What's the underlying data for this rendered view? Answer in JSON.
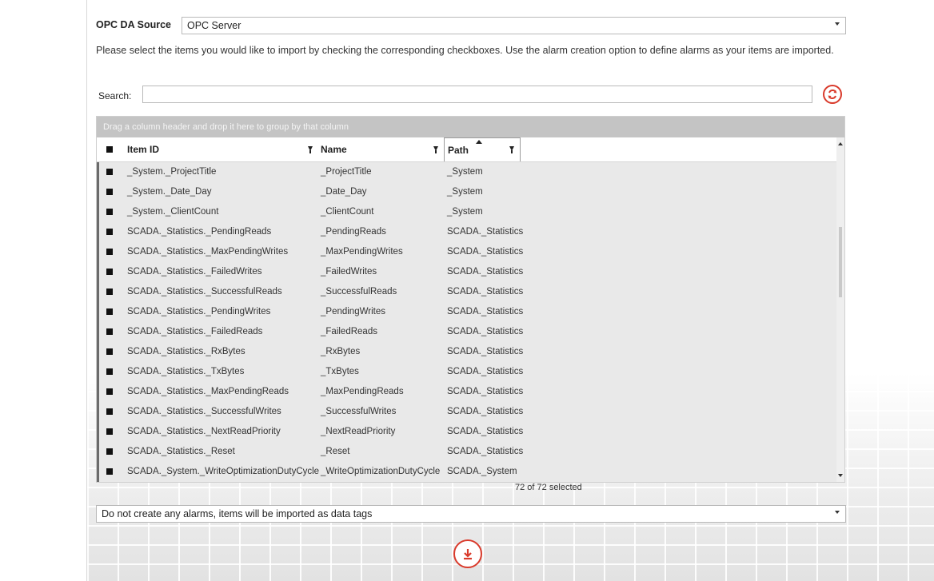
{
  "source": {
    "label": "OPC DA Source",
    "value": "OPC Server"
  },
  "instructions": "Please select the items you would like to import by checking the corresponding checkboxes. Use the alarm creation option to define alarms as your items are imported.",
  "search": {
    "label": "Search:",
    "value": "",
    "refresh_icon": "refresh-icon"
  },
  "grid": {
    "group_hint": "Drag a column header and drop it here to group by that column",
    "columns": [
      {
        "label": "Item ID"
      },
      {
        "label": "Name"
      },
      {
        "label": "Path"
      }
    ],
    "rows": [
      {
        "item_id": "_System._ProjectTitle",
        "name": "_ProjectTitle",
        "path": "_System"
      },
      {
        "item_id": "_System._Date_Day",
        "name": "_Date_Day",
        "path": "_System"
      },
      {
        "item_id": "_System._ClientCount",
        "name": "_ClientCount",
        "path": "_System"
      },
      {
        "item_id": "SCADA._Statistics._PendingReads",
        "name": "_PendingReads",
        "path": "SCADA._Statistics"
      },
      {
        "item_id": "SCADA._Statistics._MaxPendingWrites",
        "name": "_MaxPendingWrites",
        "path": "SCADA._Statistics"
      },
      {
        "item_id": "SCADA._Statistics._FailedWrites",
        "name": "_FailedWrites",
        "path": "SCADA._Statistics"
      },
      {
        "item_id": "SCADA._Statistics._SuccessfulReads",
        "name": "_SuccessfulReads",
        "path": "SCADA._Statistics"
      },
      {
        "item_id": "SCADA._Statistics._PendingWrites",
        "name": "_PendingWrites",
        "path": "SCADA._Statistics"
      },
      {
        "item_id": "SCADA._Statistics._FailedReads",
        "name": "_FailedReads",
        "path": "SCADA._Statistics"
      },
      {
        "item_id": "SCADA._Statistics._RxBytes",
        "name": "_RxBytes",
        "path": "SCADA._Statistics"
      },
      {
        "item_id": "SCADA._Statistics._TxBytes",
        "name": "_TxBytes",
        "path": "SCADA._Statistics"
      },
      {
        "item_id": "SCADA._Statistics._MaxPendingReads",
        "name": "_MaxPendingReads",
        "path": "SCADA._Statistics"
      },
      {
        "item_id": "SCADA._Statistics._SuccessfulWrites",
        "name": "_SuccessfulWrites",
        "path": "SCADA._Statistics"
      },
      {
        "item_id": "SCADA._Statistics._NextReadPriority",
        "name": "_NextReadPriority",
        "path": "SCADA._Statistics"
      },
      {
        "item_id": "SCADA._Statistics._Reset",
        "name": "_Reset",
        "path": "SCADA._Statistics"
      },
      {
        "item_id": "SCADA._System._WriteOptimizationDutyCycle",
        "name": "_WriteOptimizationDutyCycle",
        "path": "SCADA._System"
      }
    ],
    "selection_count": "72 of 72 selected"
  },
  "alarm_option": {
    "value": "Do not create any alarms, items will be imported as data tags"
  },
  "import_icon": "download-icon",
  "colors": {
    "accent": "#d93a2b",
    "group_panel": "#c4c4c4",
    "grid_bg": "#e9e9e9"
  }
}
